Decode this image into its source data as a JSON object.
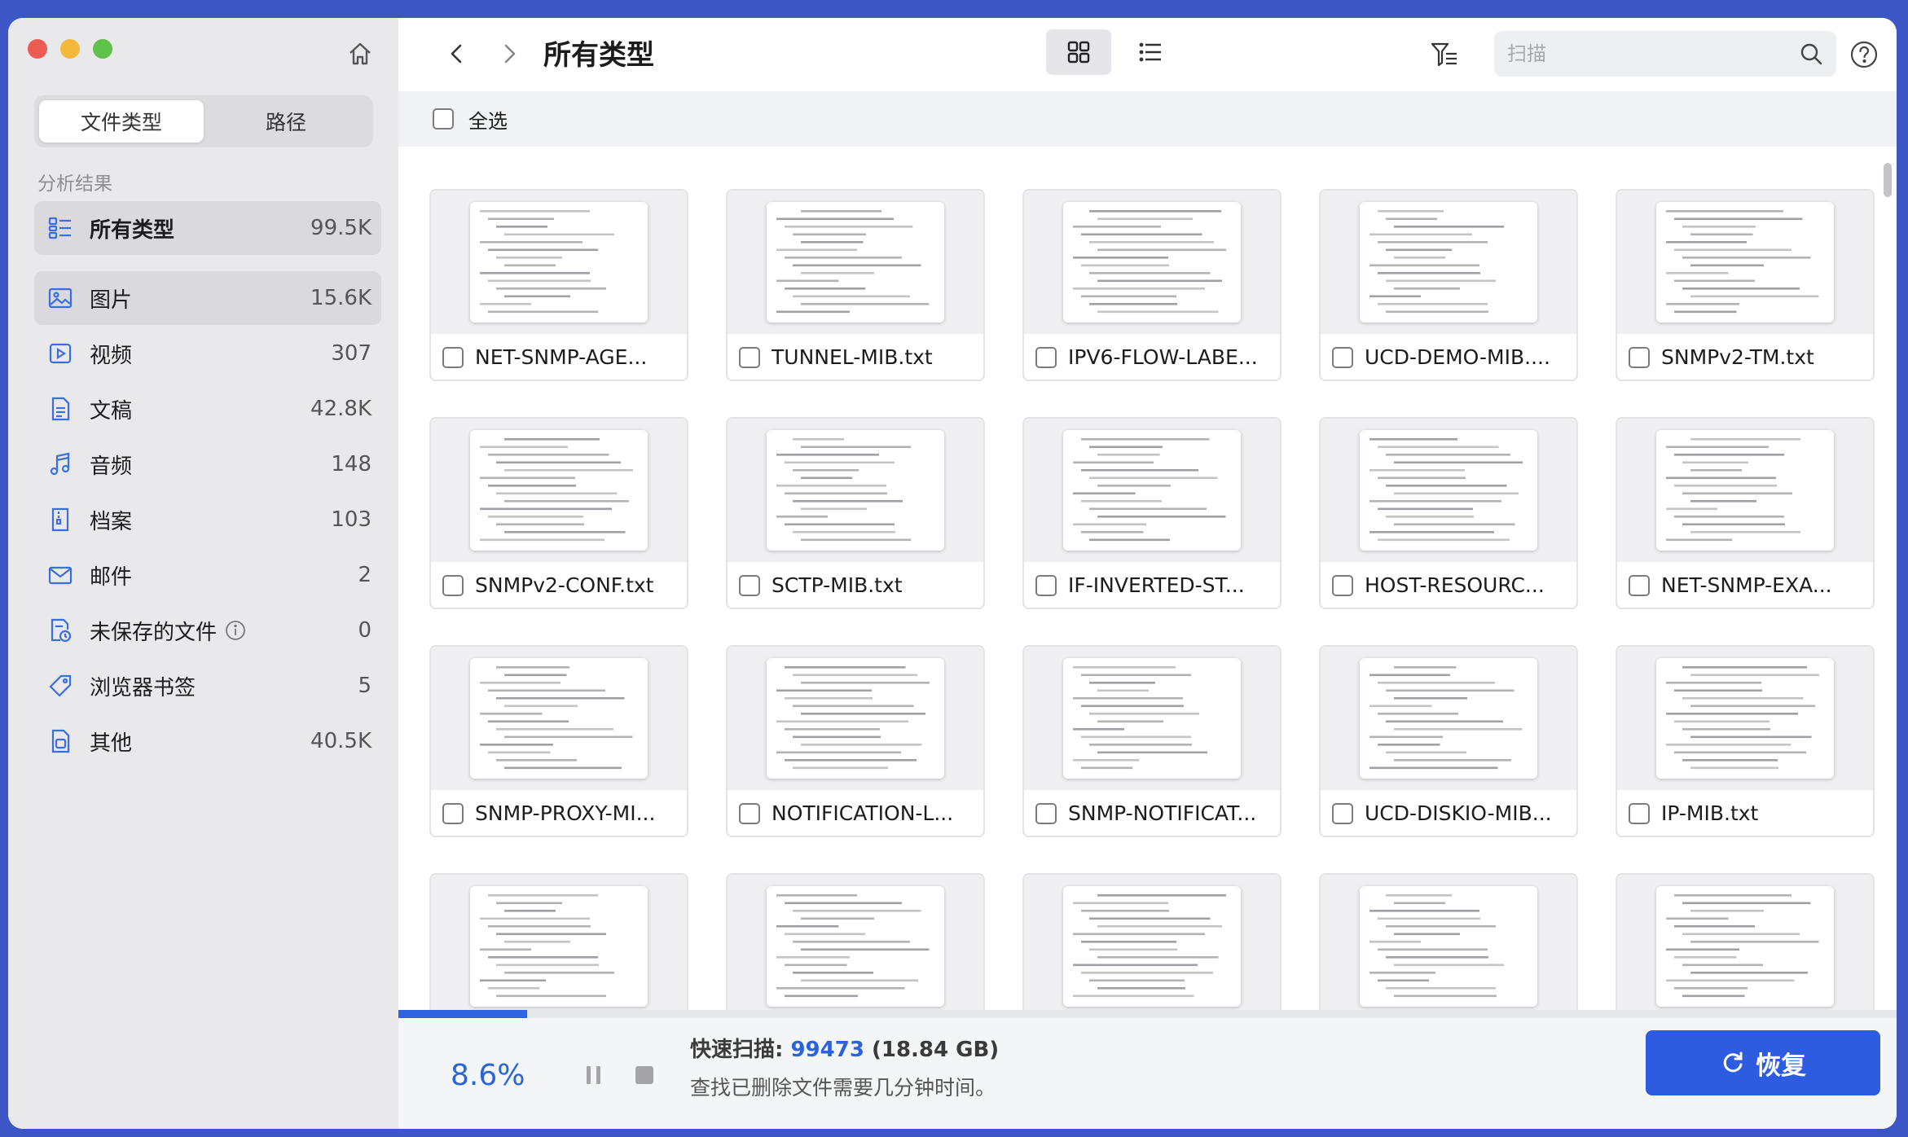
{
  "sidebar": {
    "tabs": {
      "file_type": "文件类型",
      "path": "路径"
    },
    "section_title": "分析结果",
    "items": [
      {
        "label": "所有类型",
        "count": "99.5K",
        "icon": "grid-list-icon"
      },
      {
        "label": "图片",
        "count": "15.6K",
        "icon": "image-icon"
      },
      {
        "label": "视频",
        "count": "307",
        "icon": "video-icon"
      },
      {
        "label": "文稿",
        "count": "42.8K",
        "icon": "document-icon"
      },
      {
        "label": "音频",
        "count": "148",
        "icon": "music-note-icon"
      },
      {
        "label": "档案",
        "count": "103",
        "icon": "archive-icon"
      },
      {
        "label": "邮件",
        "count": "2",
        "icon": "mail-icon"
      },
      {
        "label": "未保存的文件",
        "count": "0",
        "icon": "unsaved-file-icon"
      },
      {
        "label": "浏览器书签",
        "count": "5",
        "icon": "bookmark-tag-icon"
      },
      {
        "label": "其他",
        "count": "40.5K",
        "icon": "other-file-icon"
      }
    ]
  },
  "toolbar": {
    "title": "所有类型",
    "search_placeholder": "扫描"
  },
  "select_all_label": "全选",
  "files": [
    "NET-SNMP-AGE...",
    "TUNNEL-MIB.txt",
    "IPV6-FLOW-LABE...",
    "UCD-DEMO-MIB....",
    "SNMPv2-TM.txt",
    "SNMPv2-CONF.txt",
    "SCTP-MIB.txt",
    "IF-INVERTED-ST...",
    "HOST-RESOURC...",
    "NET-SNMP-EXA...",
    "SNMP-PROXY-MI...",
    "NOTIFICATION-L...",
    "SNMP-NOTIFICAT...",
    "UCD-DISKIO-MIB...",
    "IP-MIB.txt",
    "",
    "",
    "",
    "",
    ""
  ],
  "footer": {
    "percent": "8.6%",
    "progress_fraction": 0.086,
    "scan_label": "快速扫描: ",
    "scan_count": "99473",
    "scan_size": " (18.84 GB)",
    "subtitle": "查找已删除文件需要几分钟时间。",
    "recover_label": "恢复"
  },
  "colors": {
    "accent": "#2d5ce0",
    "background": "#3d56c6",
    "sidebar": "#e9e9ec"
  }
}
